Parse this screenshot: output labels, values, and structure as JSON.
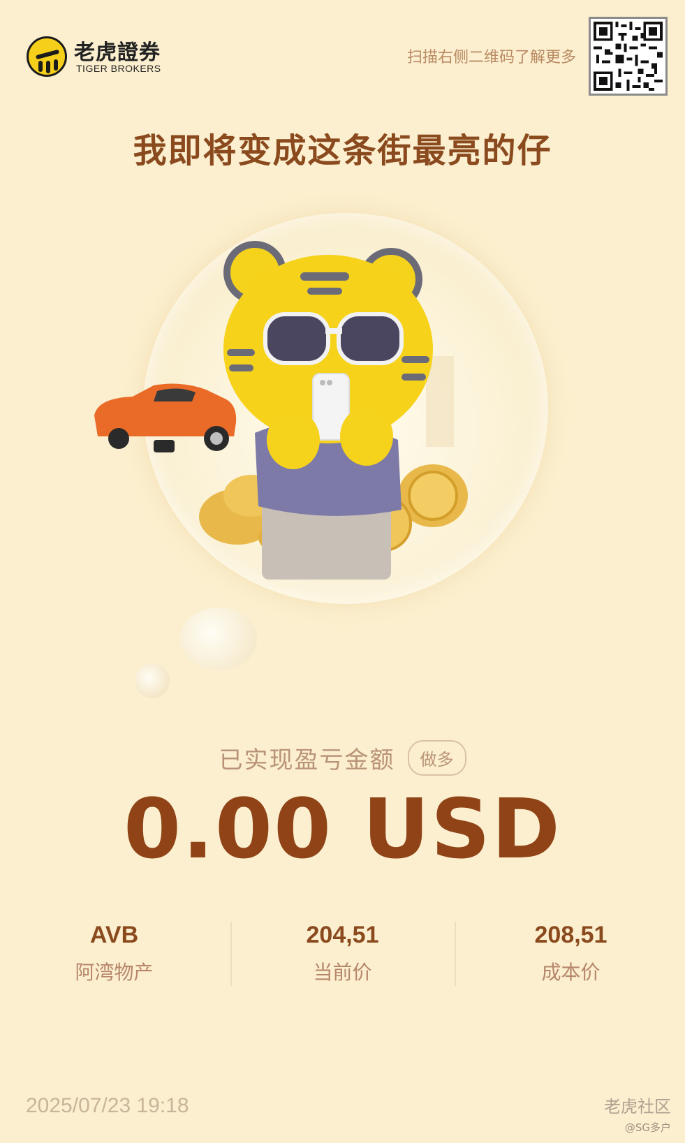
{
  "header": {
    "logo_cn": "老虎證券",
    "logo_en": "TIGER BROKERS",
    "scan_hint": "扫描右侧二维码了解更多"
  },
  "headline": "我即将变成这条街最亮的仔",
  "pnl": {
    "label": "已实现盈亏金额",
    "badge": "做多",
    "value": "0.00 USD"
  },
  "stats": [
    {
      "value": "AVB",
      "label": "阿湾物产"
    },
    {
      "value": "204,51",
      "label": "当前价"
    },
    {
      "value": "208,51",
      "label": "成本价"
    }
  ],
  "footer": {
    "timestamp": "2025/07/23 19:18",
    "watermark": "老虎社区",
    "watermark_user": "@SG多户"
  },
  "colors": {
    "background": "#fbefcf",
    "headline": "#8a4a1e",
    "value": "#8f4316",
    "muted": "#b99377"
  }
}
